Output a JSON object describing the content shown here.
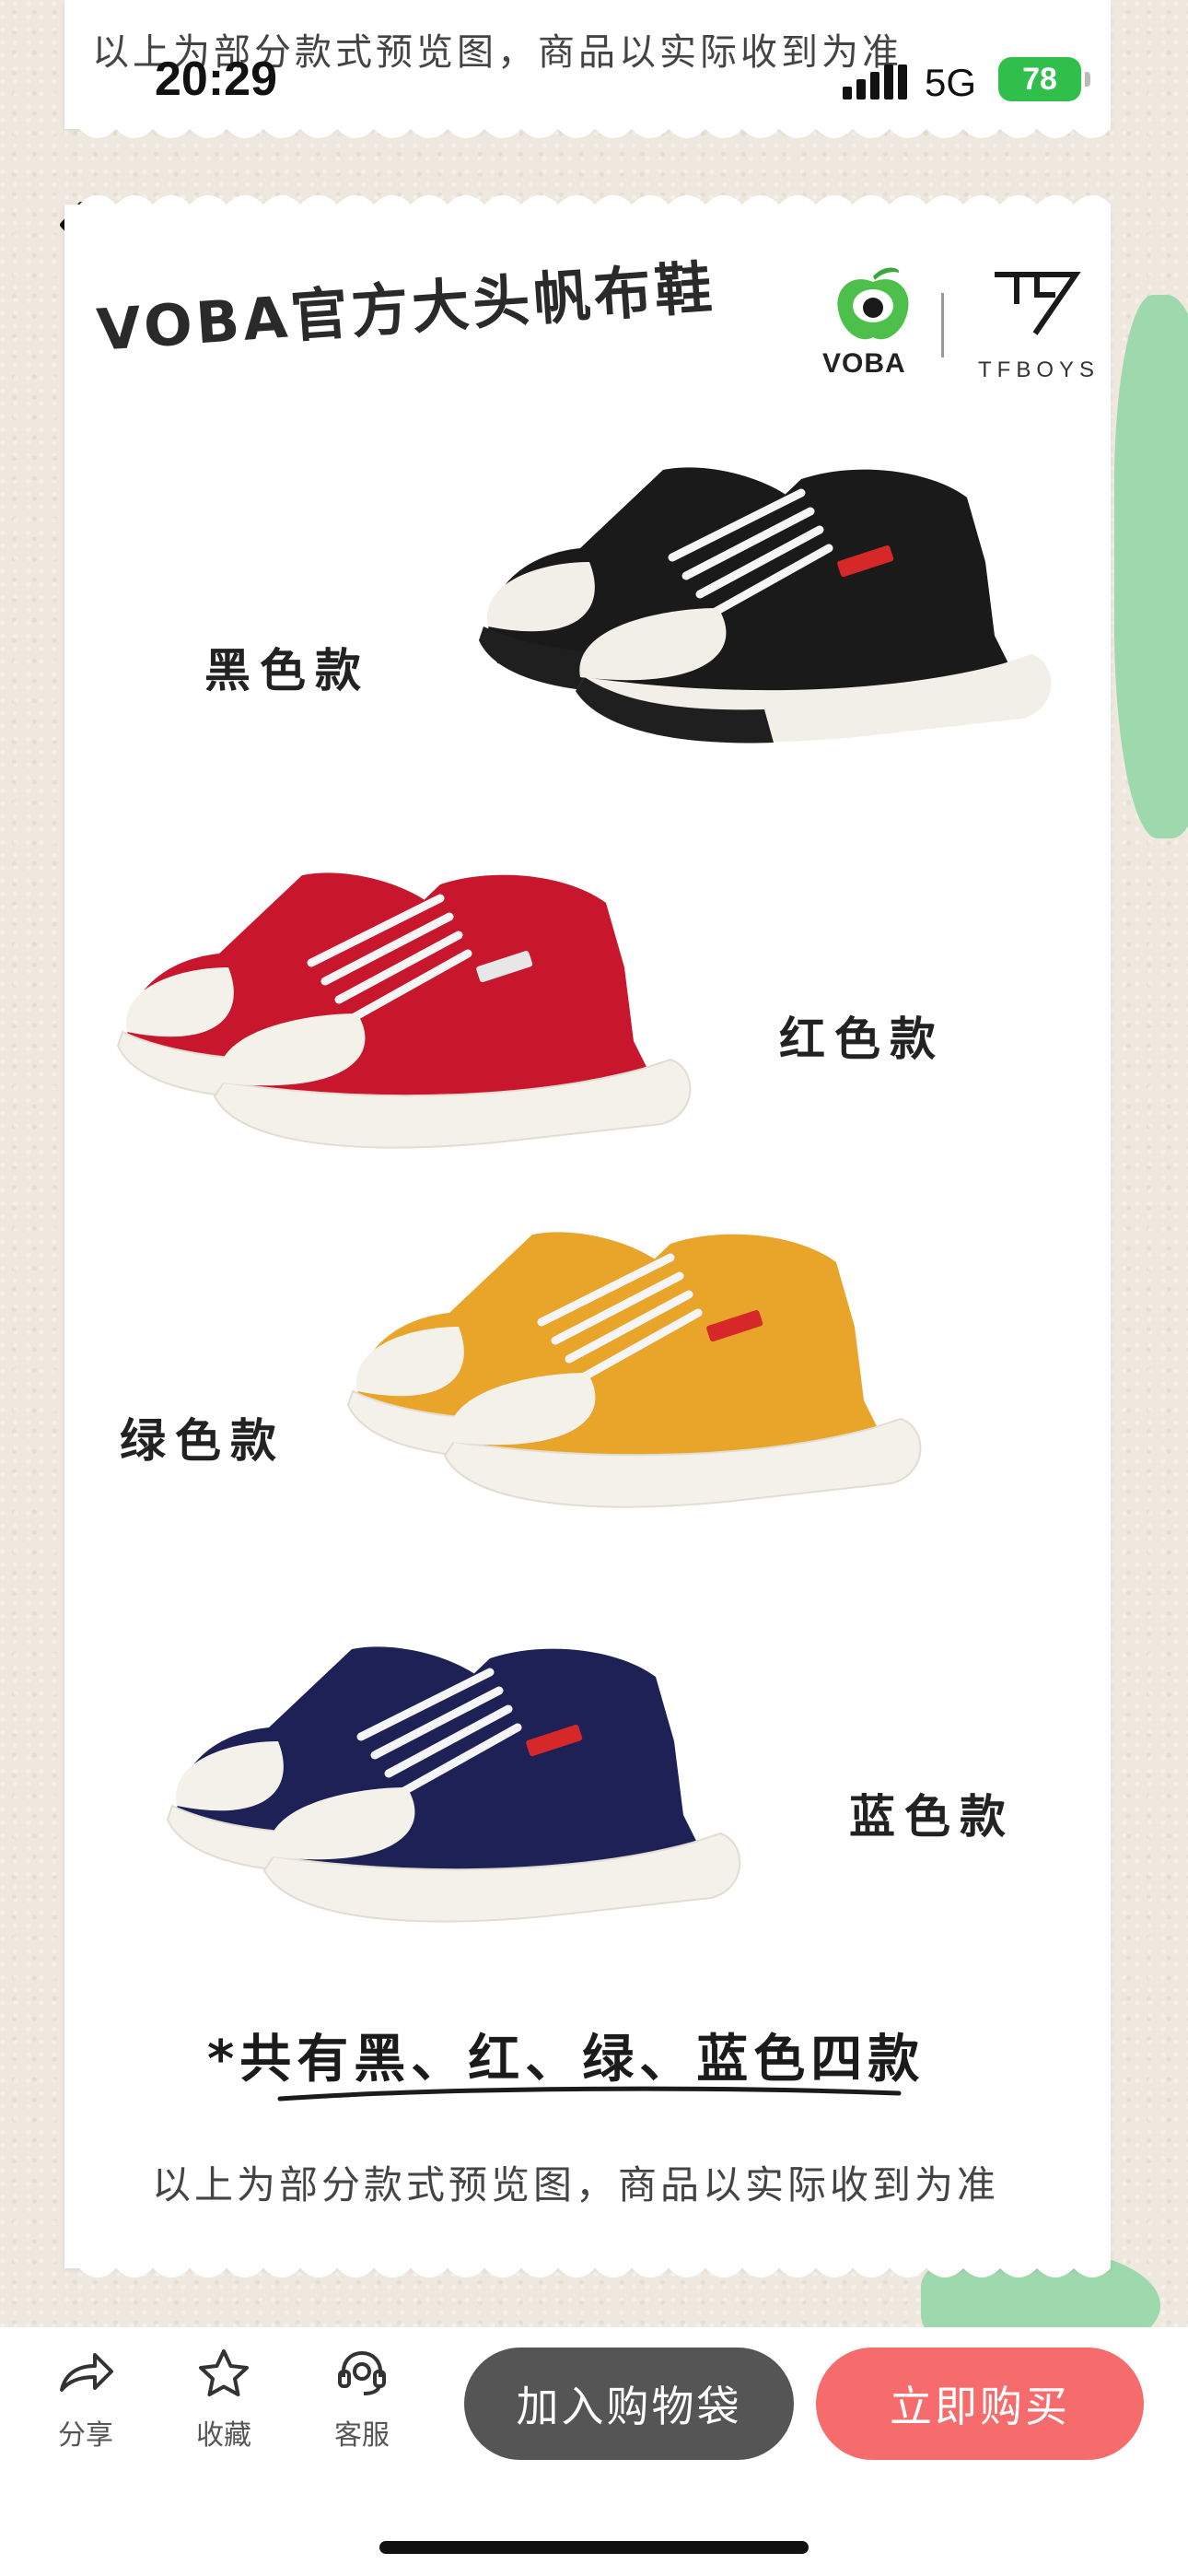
{
  "status_bar": {
    "time": "20:29",
    "network": "5G",
    "battery": "78"
  },
  "top_card": {
    "note": "以上为部分款式预览图，商品以实际收到为准"
  },
  "header": {
    "title": "VOBA官方大头帆布鞋",
    "logo_voba_text": "VOBA",
    "logo_tfboys_text": "TFBOYS"
  },
  "variants": [
    {
      "label": "黑色款",
      "upper": "#1a1a1a",
      "sole": "#1f1f1f",
      "toe": "#f2efe8"
    },
    {
      "label": "红色款",
      "upper": "#c8172d",
      "sole": "#f4f1ea",
      "toe": "#f4f1ea"
    },
    {
      "label": "绿色款",
      "upper": "#e9a42a",
      "sole": "#f4f1ea",
      "toe": "#f4f1ea"
    },
    {
      "label": "蓝色款",
      "upper": "#1e2156",
      "sole": "#f4f1ea",
      "toe": "#f4f1ea"
    }
  ],
  "summary": "*共有黑、红、绿、蓝色四款",
  "bottom_note": "以上为部分款式预览图，商品以实际收到为准",
  "toolbar": {
    "share": "分享",
    "favorite": "收藏",
    "service": "客服",
    "add_to_bag": "加入购物袋",
    "buy_now": "立即购买"
  },
  "colors": {
    "buy_button": "#f66b6b",
    "cart_button": "#555555",
    "accent_green": "#9dd9ad",
    "voba_green": "#4cc04a"
  }
}
